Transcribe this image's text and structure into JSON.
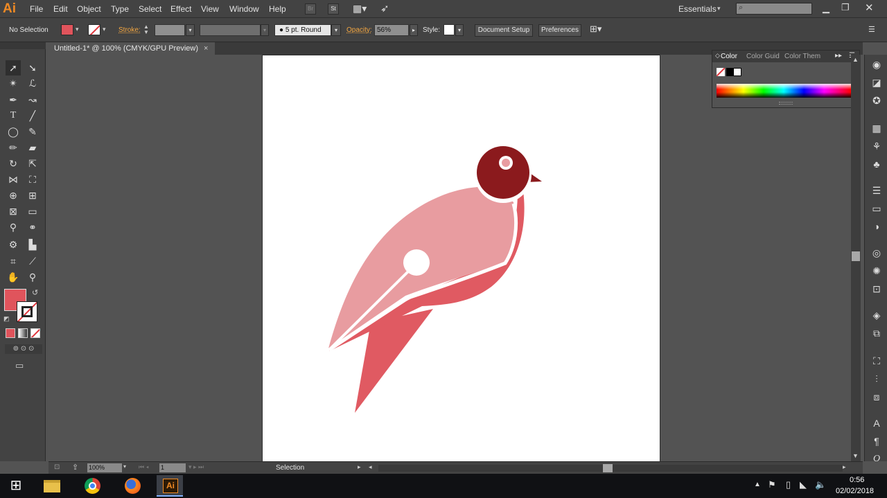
{
  "app": {
    "logo": "Ai",
    "accent": "#f08a24"
  },
  "menu": [
    "File",
    "Edit",
    "Object",
    "Type",
    "Select",
    "Effect",
    "View",
    "Window",
    "Help"
  ],
  "menu_icons": {
    "bridge": "Br",
    "stock": "St"
  },
  "workspace": {
    "label": "Essentials"
  },
  "control": {
    "selection": "No Selection",
    "fill_color": "#e0545c",
    "stroke_label": "Stroke:",
    "brush": "5 pt. Round",
    "opacity_label": "Opacity:",
    "opacity_value": "56%",
    "style_label": "Style:",
    "doc_setup": "Document Setup",
    "preferences": "Preferences"
  },
  "document": {
    "tab_title": "Untitled-1* @ 100% (CMYK/GPU Preview)",
    "close": "×"
  },
  "color_panel": {
    "tabs": [
      "Color",
      "Color Guid",
      "Color Them"
    ]
  },
  "status": {
    "zoom": "100%",
    "page": "1",
    "tool": "Selection"
  },
  "tray": {
    "time": "0:56",
    "date": "02/02/2018"
  },
  "artwork": {
    "head": "#8b1a1d",
    "body": "#e89ca0",
    "wing": "#e05a62",
    "tail": "#e05a62",
    "beak": "#8b1a1d",
    "eye": "#e89ca0"
  }
}
